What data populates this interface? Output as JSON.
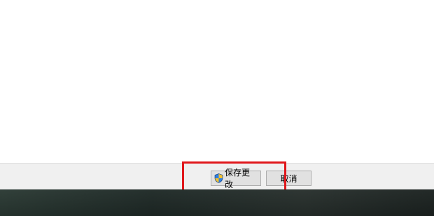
{
  "footer": {
    "save_button_label": "保存更改",
    "cancel_button_label": "取消",
    "save_button_icon": "uac-shield-icon"
  },
  "annotation": {
    "highlight_color": "#e0171b"
  },
  "colors": {
    "footer_background": "#f0f0f0",
    "button_background": "#e1e1e1",
    "taskbar_background": "#1f2a27"
  }
}
